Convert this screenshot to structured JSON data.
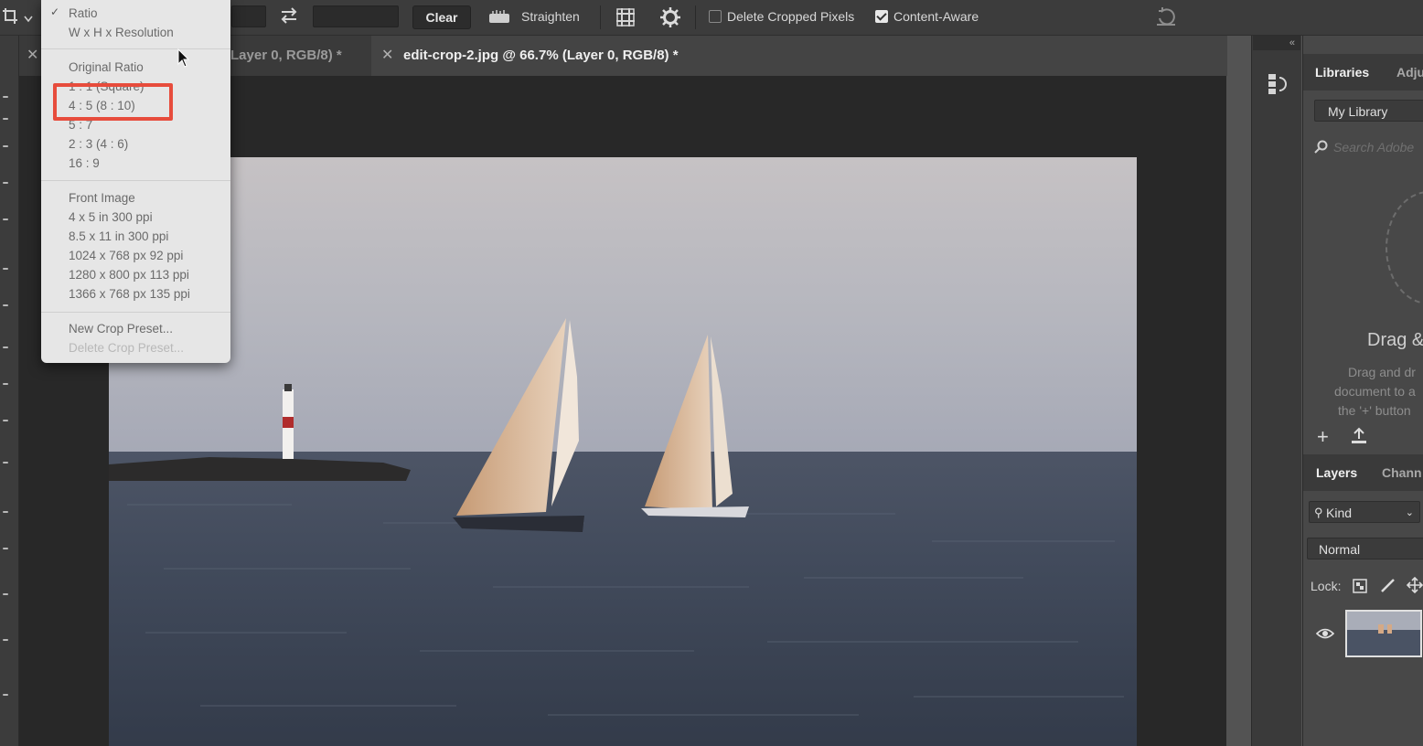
{
  "options_bar": {
    "clear_label": "Clear",
    "straighten_label": "Straighten",
    "delete_cropped_label": "Delete Cropped Pixels",
    "delete_cropped_checked": false,
    "content_aware_label": "Content-Aware",
    "content_aware_checked": true
  },
  "tabs": [
    {
      "label": "Layer 0, RGB/8) *",
      "active": false
    },
    {
      "label": "edit-crop-2.jpg @ 66.7% (Layer 0, RGB/8) *",
      "active": true
    }
  ],
  "crop_menu": {
    "checked_item": "Ratio",
    "group1": [
      "Ratio",
      "W x H x Resolution"
    ],
    "group2": [
      "Original Ratio",
      "1 : 1 (Square)",
      "4 : 5 (8 : 10)",
      "5 : 7",
      "2 : 3 (4 : 6)",
      "16 : 9"
    ],
    "group3": [
      "Front Image",
      "4 x 5 in 300 ppi",
      "8.5 x 11 in 300 ppi",
      "1024 x 768 px 92 ppi",
      "1280 x 800 px 113 ppi",
      "1366 x 768 px 135 ppi"
    ],
    "group4": [
      "New Crop Preset...",
      "Delete Crop Preset..."
    ],
    "highlighted_item": "4 : 5 (8 : 10)"
  },
  "right_panel": {
    "libraries_tab": "Libraries",
    "adjust_tab": "Adju",
    "library_select": "My Library",
    "search_placeholder": "Search Adobe",
    "drag_heading": "Drag &",
    "drag_text_1": "Drag and dr",
    "drag_text_2": "document to a",
    "drag_text_3": "the '+' button",
    "layers_tab": "Layers",
    "channels_tab": "Chann",
    "kind_filter": "Kind",
    "blend_mode": "Normal",
    "lock_label": "Lock:"
  },
  "colors": {
    "highlight": "#e74c3c",
    "menu_bg": "#e6e6e6",
    "ui_dark": "#3c3c3c"
  }
}
